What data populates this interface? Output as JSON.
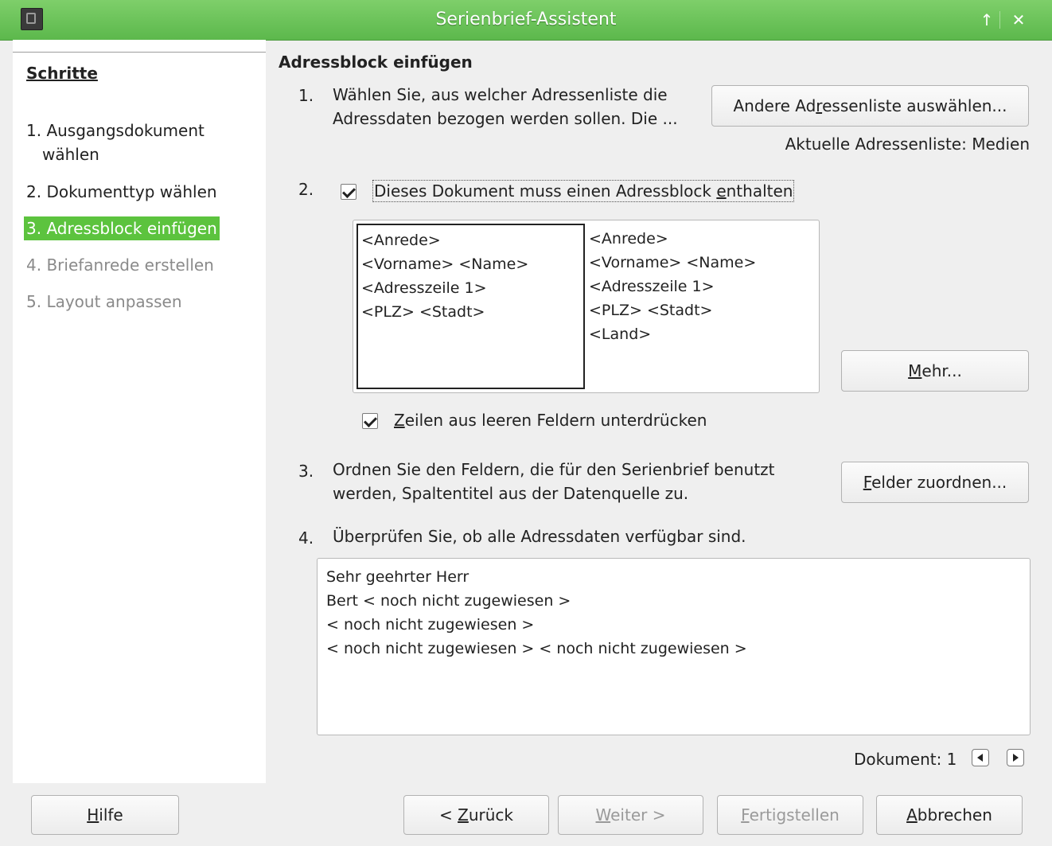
{
  "window": {
    "title": "Serienbrief-Assistent",
    "icon": "document-icon",
    "controls": {
      "maximize": "↑",
      "close": "✕"
    }
  },
  "sidebar": {
    "heading": "Schritte",
    "steps": [
      {
        "label_line1": "1. Ausgangsdokument",
        "label_line2": "wählen",
        "state": "normal"
      },
      {
        "label": "2. Dokumenttyp wählen",
        "state": "normal"
      },
      {
        "label": "3. Adressblock einfügen",
        "state": "active"
      },
      {
        "label": "4. Briefanrede erstellen",
        "state": "disabled"
      },
      {
        "label": "5. Layout anpassen",
        "state": "disabled"
      }
    ]
  },
  "main": {
    "heading": "Adressblock einfügen",
    "step1": {
      "number": "1.",
      "text_line1": "Wählen Sie, aus welcher Adressenliste die",
      "text_line2": "Adressdaten bezogen werden sollen. Die ...",
      "button_pre": "Andere Ad",
      "button_mnemonic": "r",
      "button_post": "essenliste auswählen...",
      "current_list": "Aktuelle Adressenliste: Medien"
    },
    "step2": {
      "number": "2.",
      "checkbox_pre": "Dieses Dokument muss einen Adressblock ",
      "checkbox_mnemonic": "e",
      "checkbox_post": "nthalten",
      "checked": true,
      "block1": [
        "<Anrede>",
        "<Vorname> <Name>",
        "<Adresszeile 1>",
        "<PLZ> <Stadt>"
      ],
      "block2": [
        "<Anrede>",
        "<Vorname> <Name>",
        "<Adresszeile 1>",
        "<PLZ> <Stadt>",
        "<Land>"
      ],
      "more_mnemonic": "M",
      "more_rest": "ehr...",
      "suppress_mnemonic": "Z",
      "suppress_rest": "eilen aus leeren Feldern unterdrücken",
      "suppress_checked": true
    },
    "step3": {
      "number": "3.",
      "text_line1": "Ordnen Sie den Feldern, die für den Serienbrief benutzt",
      "text_line2": "werden, Spaltentitel aus der Datenquelle zu.",
      "button_mnemonic": "F",
      "button_rest": "elder zuordnen..."
    },
    "step4": {
      "number": "4.",
      "text": "Überprüfen Sie, ob alle Adressdaten verfügbar sind.",
      "preview": [
        "Sehr geehrter Herr",
        "Bert < noch nicht zugewiesen >",
        "< noch nicht zugewiesen >",
        "< noch nicht zugewiesen > < noch nicht zugewiesen >"
      ],
      "document_label": "Dokument: 1"
    }
  },
  "footer": {
    "help_mnemonic": "H",
    "help_rest": "ilfe",
    "back_pre": "< ",
    "back_mnemonic": "Z",
    "back_rest": "urück",
    "next_mnemonic": "W",
    "next_rest": "eiter >",
    "finish_mnemonic": "F",
    "finish_rest": "ertigstellen",
    "cancel_mnemonic": "A",
    "cancel_rest": "bbrechen"
  }
}
